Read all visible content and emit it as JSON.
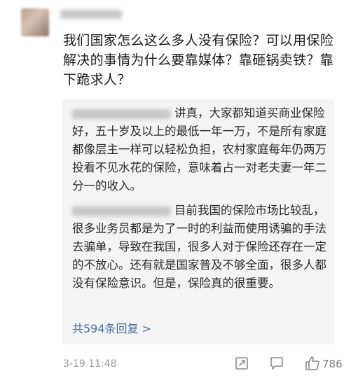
{
  "comment": {
    "text": "我们国家怎么这么多人没有保险？可以用保险解决的事情为什么要靠媒体？靠砸锅卖铁？靠下跪求人？",
    "timestamp": "3-19 11:48",
    "like_count": "786"
  },
  "replies": [
    {
      "text": "讲真，大家都知道买商业保险好，五十岁及以上的最低一年一万，不是所有家庭都像层主一样可以轻松负担，农村家庭每年仍两万投看不见水花的保险，意味着占一对老夫妻一年二分一的收入。"
    },
    {
      "text": "目前我国的保险市场比较乱，很多业务员都是为了一时的利益而使用诱骗的手法去骗单，导致在我国，很多人对于保险还存在一定的不放心。还有就是国家普及不够全面，很多人都没有保险意识。但是，保险真的很重要。"
    }
  ],
  "more_replies_label": "共594条回复 >",
  "icons": {
    "share": "share-icon",
    "reply": "reply-icon",
    "like": "thumbs-up-icon"
  },
  "colors": {
    "link": "#4a6d99",
    "reply_bg": "#f4f4f4",
    "meta": "#9a9a9a"
  }
}
